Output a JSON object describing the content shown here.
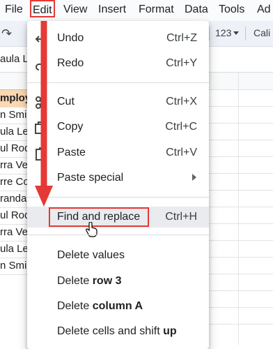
{
  "menubar": {
    "items": [
      "File",
      "Edit",
      "View",
      "Insert",
      "Format",
      "Data",
      "Tools",
      "Ad"
    ]
  },
  "toolbar": {
    "number_format": "123",
    "font": "Cali"
  },
  "formula_bar": {
    "value": "aula Le"
  },
  "sheet": {
    "column_a": [
      "mploy",
      "n Smi",
      "ula Le",
      "ul Rod",
      "rra Ve",
      "rre Co",
      "randa",
      "ul Rod",
      "rra Ve",
      "ula Le",
      "n Smi"
    ]
  },
  "edit_menu": {
    "undo": {
      "label": "Undo",
      "shortcut": "Ctrl+Z"
    },
    "redo": {
      "label": "Redo",
      "shortcut": "Ctrl+Y"
    },
    "cut": {
      "label": "Cut",
      "shortcut": "Ctrl+X"
    },
    "copy": {
      "label": "Copy",
      "shortcut": "Ctrl+C"
    },
    "paste": {
      "label": "Paste",
      "shortcut": "Ctrl+V"
    },
    "paste_special": {
      "label": "Paste special"
    },
    "find_replace": {
      "label": "Find and replace",
      "shortcut": "Ctrl+H"
    },
    "delete_values": {
      "label": "Delete values"
    },
    "delete_row": {
      "label_prefix": "Delete ",
      "label_bold": "row 3"
    },
    "delete_column": {
      "label_prefix": "Delete ",
      "label_bold": "column A"
    },
    "delete_shift": {
      "label_prefix": "Delete cells and shift ",
      "label_bold": "up"
    }
  },
  "colors": {
    "annotation": "#e53935",
    "header_fill": "#fbd7b2",
    "menu_highlight": "#e9ebee"
  }
}
